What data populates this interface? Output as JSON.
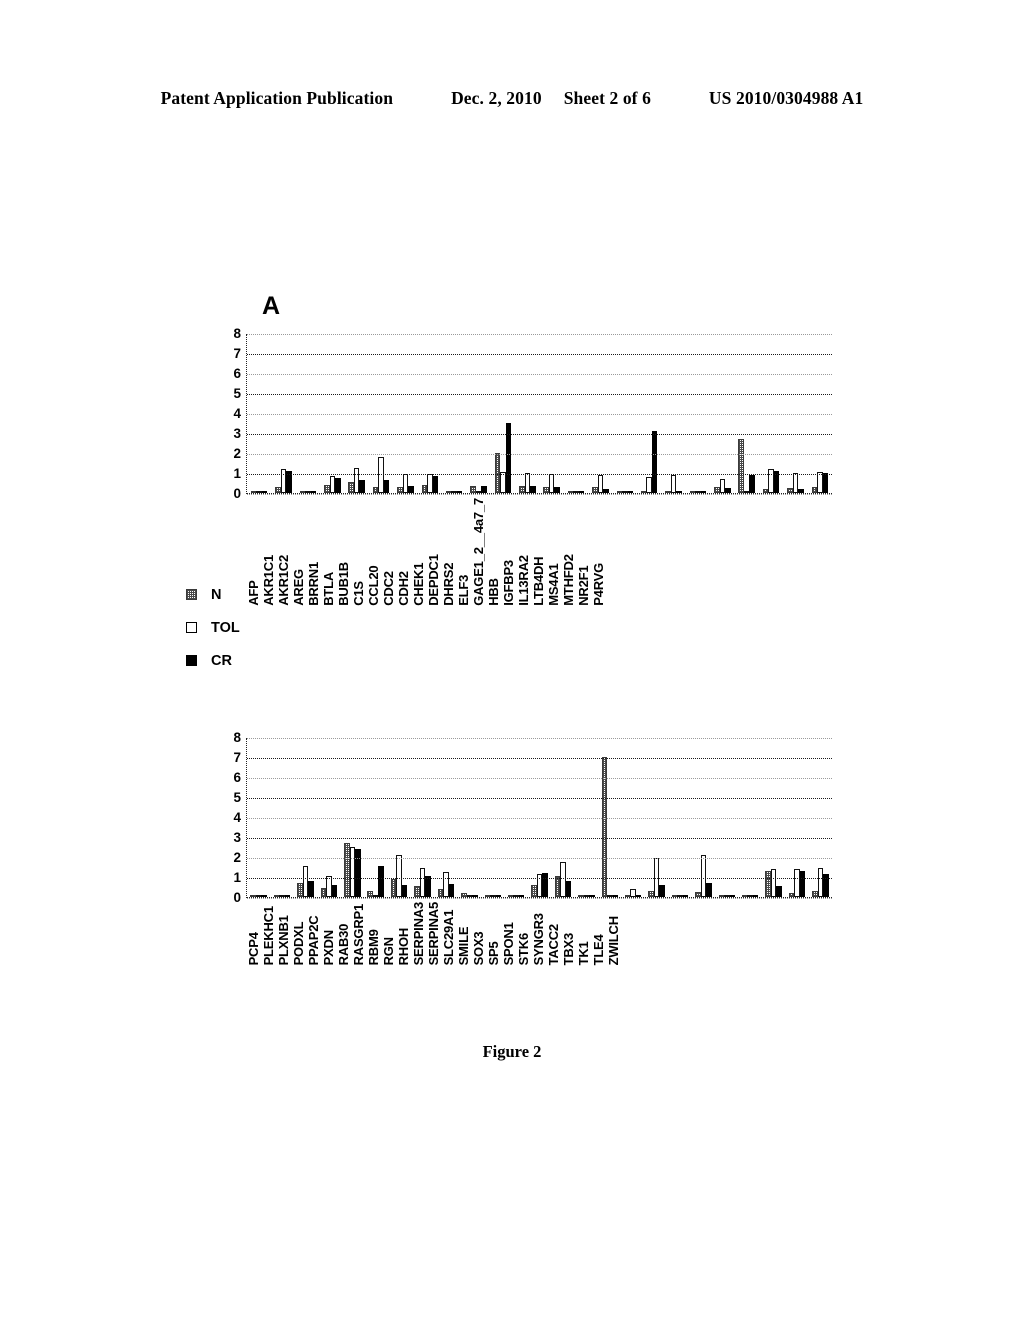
{
  "header": {
    "publication": "Patent Application Publication",
    "date": "Dec. 2, 2010",
    "sheet": "Sheet 2 of 6",
    "number": "US 2010/0304988 A1"
  },
  "panel_letter": "A",
  "caption": "Figure 2",
  "legend": {
    "items": [
      {
        "key": "n",
        "label": "N"
      },
      {
        "key": "tol",
        "label": "TOL"
      },
      {
        "key": "cr",
        "label": "CR"
      }
    ]
  },
  "yticks": [
    "8",
    "7",
    "6",
    "5",
    "4",
    "3",
    "2",
    "1",
    "0"
  ],
  "chart_data": [
    {
      "type": "bar",
      "title": "A",
      "xlabel": "",
      "ylabel": "",
      "ylim": [
        0,
        8
      ],
      "grid": true,
      "legend_position": "below-left",
      "categories": [
        "AFP",
        "AKR1C1",
        "AKR1C2",
        "AREG",
        "BRRN1",
        "BTLA",
        "BUB1B",
        "C1S",
        "CCL20",
        "CDC2",
        "CDH2",
        "CHEK1",
        "DEPDC1",
        "DHRS2",
        "ELF3",
        "GAGE1_2__4a7_7",
        "HBB",
        "IGFBP3",
        "IL13RA2",
        "LTB4DH",
        "MS4A1",
        "MTHFD2",
        "NR2F1",
        "P4RVG"
      ],
      "series": [
        {
          "name": "N",
          "values": [
            0.08,
            0.32,
            0.05,
            0.42,
            0.55,
            0.3,
            0.3,
            0.4,
            0.05,
            0.35,
            2.0,
            0.35,
            0.3,
            0.12,
            0.3,
            0.05,
            0.05,
            0.1,
            0.05,
            0.3,
            2.7,
            0.22,
            0.25,
            0.3
          ]
        },
        {
          "name": "TOL",
          "values": [
            0.05,
            1.2,
            0.05,
            0.85,
            1.25,
            1.8,
            0.95,
            0.95,
            0.06,
            0.05,
            1.05,
            1.0,
            0.95,
            0.1,
            0.9,
            0.04,
            0.8,
            0.92,
            0.04,
            0.7,
            0.12,
            1.2,
            0.98,
            1.05
          ]
        },
        {
          "name": "CR",
          "values": [
            0.06,
            1.1,
            0.05,
            0.75,
            0.65,
            0.65,
            0.35,
            0.85,
            0.05,
            0.35,
            3.5,
            0.35,
            0.28,
            0.08,
            0.2,
            0.05,
            3.1,
            0.1,
            0.05,
            0.25,
            0.9,
            1.1,
            0.18,
            1.0
          ]
        }
      ]
    },
    {
      "type": "bar",
      "title": "",
      "xlabel": "",
      "ylabel": "",
      "ylim": [
        0,
        8
      ],
      "grid": true,
      "legend_position": "shared",
      "categories": [
        "PCP4",
        "PLEKHC1",
        "PLXNB1",
        "PODXL",
        "PPAP2C",
        "PXDN",
        "RAB30",
        "RASGRP1",
        "RBM9",
        "RGN",
        "RHOH",
        "SERPINA3",
        "SERPINA5",
        "SLC29A1",
        "SMILE",
        "SOX3",
        "SP5",
        "SPON1",
        "STK6",
        "SYNGR3",
        "TACC2",
        "TBX3",
        "TK1",
        "TLE4",
        "ZWILCH"
      ],
      "series": [
        {
          "name": "N",
          "values": [
            0.04,
            0.05,
            0.72,
            0.45,
            2.7,
            0.3,
            0.9,
            0.55,
            0.4,
            0.2,
            0.06,
            0.05,
            0.6,
            1.05,
            0.05,
            7.0,
            0.04,
            0.3,
            0.05,
            0.25,
            0.04,
            0.05,
            1.3,
            0.18,
            0.3
          ]
        },
        {
          "name": "TOL",
          "values": [
            0.04,
            0.05,
            1.55,
            1.05,
            2.5,
            0.12,
            2.1,
            1.45,
            1.25,
            0.05,
            0.05,
            0.05,
            1.15,
            1.75,
            0.05,
            0.1,
            0.4,
            1.95,
            0.05,
            2.1,
            0.04,
            0.05,
            1.4,
            1.4,
            1.45
          ]
        },
        {
          "name": "CR",
          "values": [
            0.04,
            0.05,
            0.78,
            0.62,
            2.4,
            1.55,
            0.6,
            1.05,
            0.65,
            0.05,
            0.05,
            0.05,
            1.2,
            0.78,
            0.05,
            0.05,
            0.05,
            0.62,
            0.05,
            0.7,
            0.04,
            0.05,
            0.55,
            1.3,
            1.15
          ]
        }
      ]
    }
  ]
}
